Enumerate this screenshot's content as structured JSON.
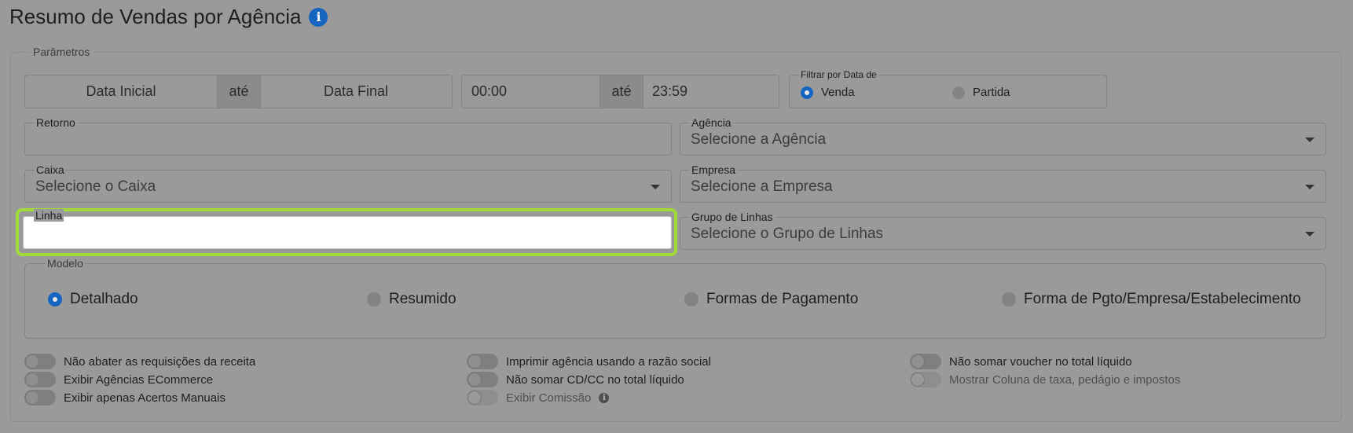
{
  "page": {
    "title": "Resumo de Vendas por Agência"
  },
  "params": {
    "legend": "Parâmetros",
    "date_start_placeholder": "Data Inicial",
    "ate": "até",
    "date_end_placeholder": "Data Final",
    "time_start": "00:00",
    "time_end": "23:59",
    "filter": {
      "label": "Filtrar por Data de",
      "options": [
        "Venda",
        "Partida"
      ],
      "selected": "Venda"
    },
    "retorno": {
      "label": "Retorno",
      "value": ""
    },
    "agencia": {
      "label": "Agência",
      "placeholder": "Selecione a Agência"
    },
    "caixa": {
      "label": "Caixa",
      "placeholder": "Selecione o Caixa"
    },
    "empresa": {
      "label": "Empresa",
      "placeholder": "Selecione a Empresa"
    },
    "linha": {
      "label": "Linha",
      "value": ""
    },
    "grupo": {
      "label": "Grupo de Linhas",
      "placeholder": "Selecione o Grupo de Linhas"
    }
  },
  "modelo": {
    "legend": "Modelo",
    "options": [
      "Detalhado",
      "Resumido",
      "Formas de Pagamento",
      "Forma de Pgto/Empresa/Estabelecimento"
    ],
    "selected": "Detalhado"
  },
  "toggles": {
    "col1": [
      "Não abater as requisições da receita",
      "Exibir Agências ECommerce",
      "Exibir apenas Acertos Manuais"
    ],
    "col2": [
      "Imprimir agência usando a razão social",
      "Não somar CD/CC no total líquido",
      "Exibir Comissão"
    ],
    "col3": [
      "Não somar voucher no total líquido",
      "Mostrar Coluna de taxa, pedágio e impostos"
    ]
  },
  "colors": {
    "accent": "#1565c0",
    "highlight": "#9fdc3a"
  }
}
